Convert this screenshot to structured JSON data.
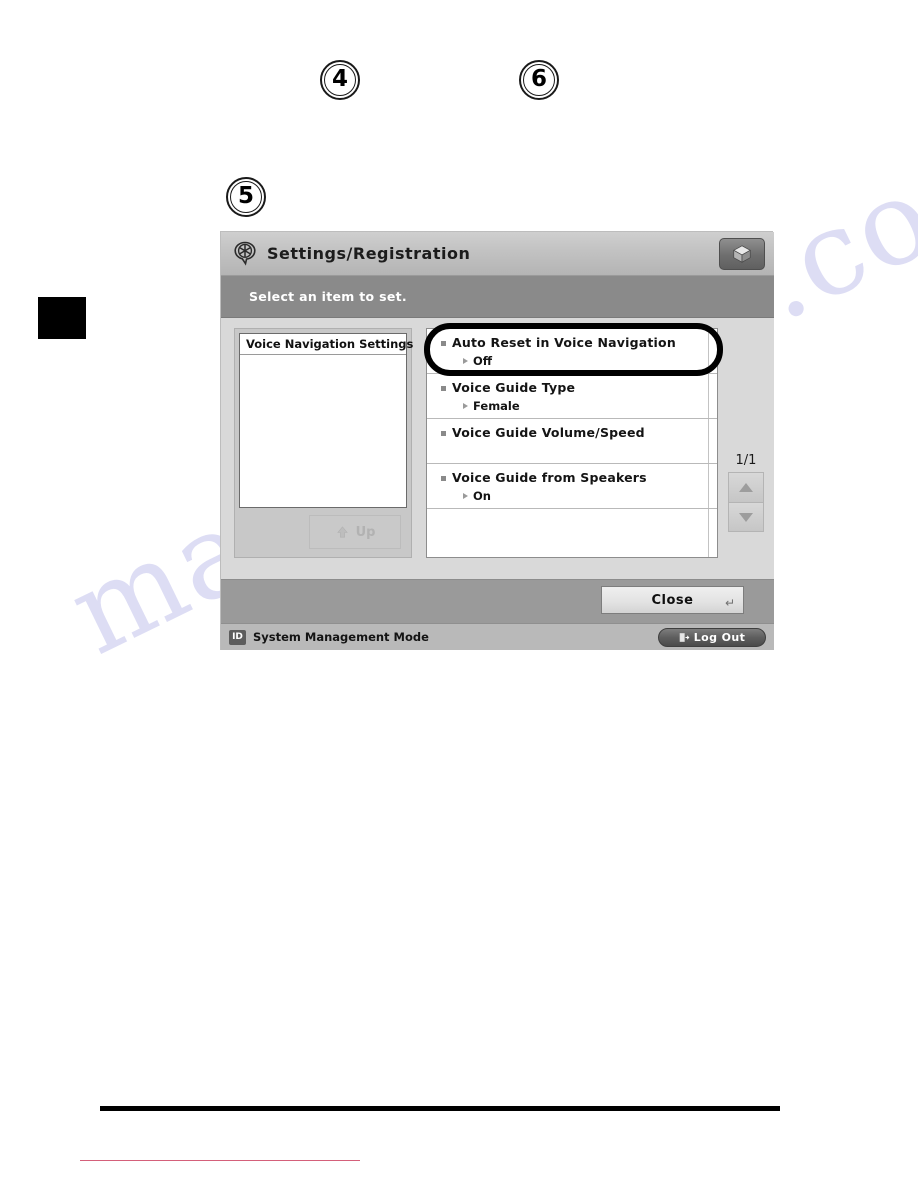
{
  "page": {
    "watermark_text": "manualshive.com",
    "callouts": [
      {
        "name": "callout-4",
        "label": "4"
      },
      {
        "name": "callout-6",
        "label": "6"
      },
      {
        "name": "callout-5",
        "label": "5"
      }
    ]
  },
  "screen": {
    "header": {
      "title": "Settings/Registration",
      "settings_icon": "settings-registration-icon",
      "cube_icon": "cube-icon"
    },
    "instruction": "Select an item to set.",
    "left_panel": {
      "breadcrumb_title": "Voice Navigation Settings",
      "up_button_label": "Up",
      "up_icon": "up-arrow-icon"
    },
    "list": {
      "rows": [
        {
          "title": "Auto Reset in Voice Navigation",
          "value": "Off",
          "highlighted": true
        },
        {
          "title": "Voice Guide Type",
          "value": "Female",
          "highlighted": false
        },
        {
          "title": "Voice Guide Volume/Speed",
          "value": "",
          "highlighted": false
        },
        {
          "title": "Voice Guide from Speakers",
          "value": "On",
          "highlighted": false
        },
        {
          "title": "",
          "value": "",
          "highlighted": false
        }
      ]
    },
    "pager": {
      "indicator": "1/1",
      "up_icon": "triangle-up-icon",
      "down_icon": "triangle-down-icon"
    },
    "footer": {
      "close_label": "Close",
      "enter_glyph": "↵"
    },
    "status": {
      "id_badge": "ID",
      "mode_text": "System Management Mode",
      "logout_label": "Log Out",
      "logout_icon": "logout-door-icon"
    }
  }
}
